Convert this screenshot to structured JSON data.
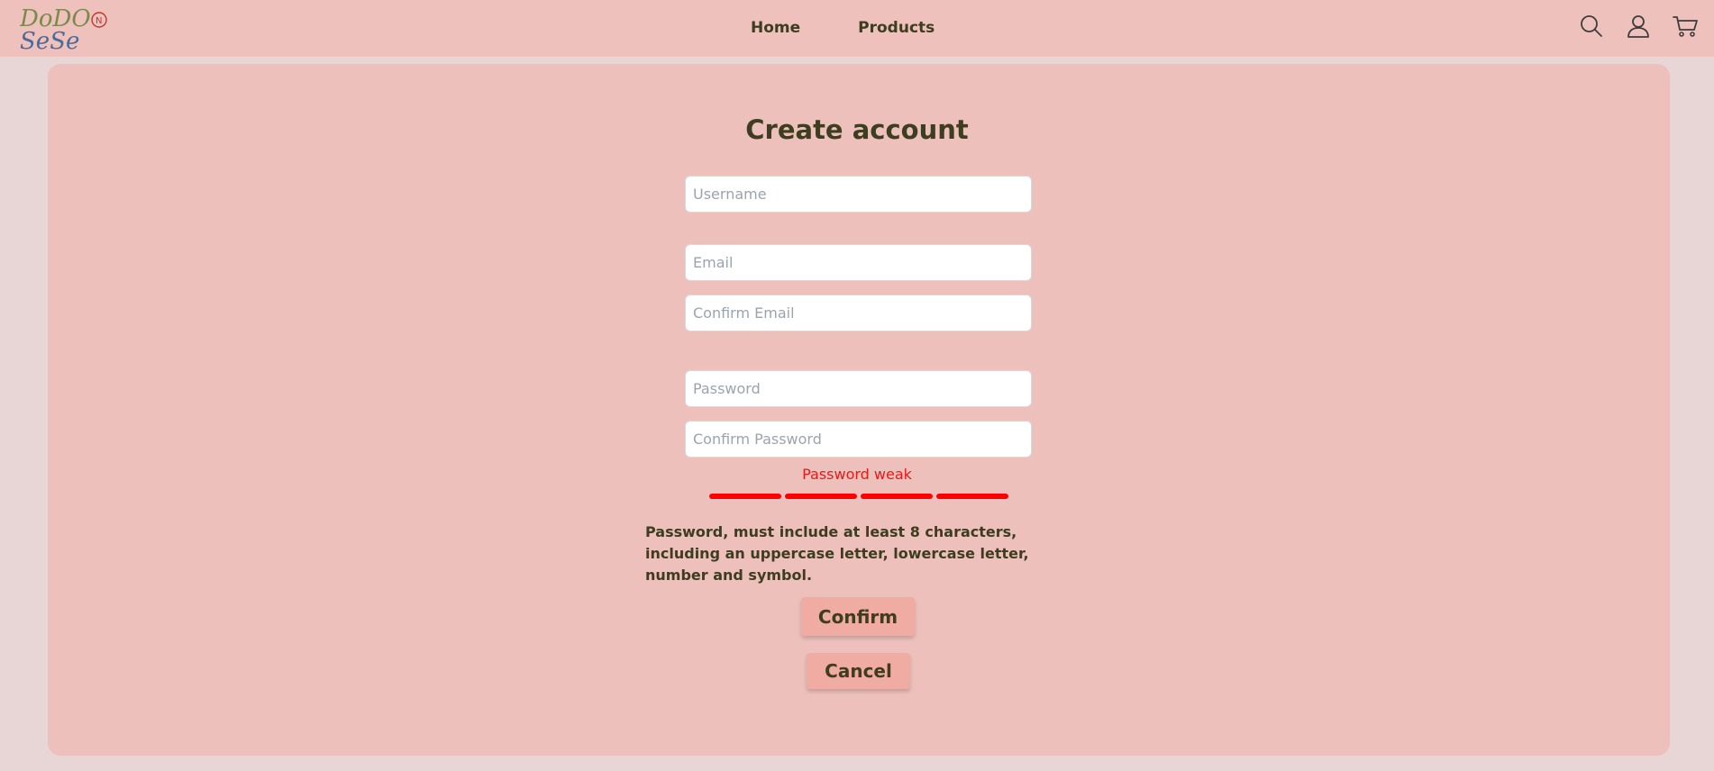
{
  "brand": {
    "logo_line1": "DoDO",
    "logo_line2": "SeSe",
    "logo_mark": "N"
  },
  "nav": {
    "links": [
      {
        "label": "Home"
      },
      {
        "label": "Products"
      }
    ],
    "icons": [
      "search-icon",
      "user-icon",
      "cart-icon"
    ]
  },
  "form": {
    "title": "Create account",
    "fields": {
      "username": {
        "placeholder": "Username",
        "value": ""
      },
      "email": {
        "placeholder": "Email",
        "value": ""
      },
      "confirm_email": {
        "placeholder": "Confirm Email",
        "value": ""
      },
      "password": {
        "placeholder": "Password",
        "value": ""
      },
      "confirm_password": {
        "placeholder": "Confirm Password",
        "value": ""
      }
    },
    "strength": {
      "label": "Password weak",
      "segments_filled": 4,
      "segments_total": 4,
      "color": "#ff0000"
    },
    "hint": "Password, must include at least 8 characters, including an uppercase letter, lowercase letter, number and symbol.",
    "confirm_label": "Confirm",
    "cancel_label": "Cancel"
  },
  "colors": {
    "navbar_bg": "#efc1bd",
    "card_bg": "#eec0bc",
    "page_bg": "#e8d5d5",
    "button_bg": "#f0aca3",
    "text": "#3d3d1f",
    "error": "#e81919"
  }
}
